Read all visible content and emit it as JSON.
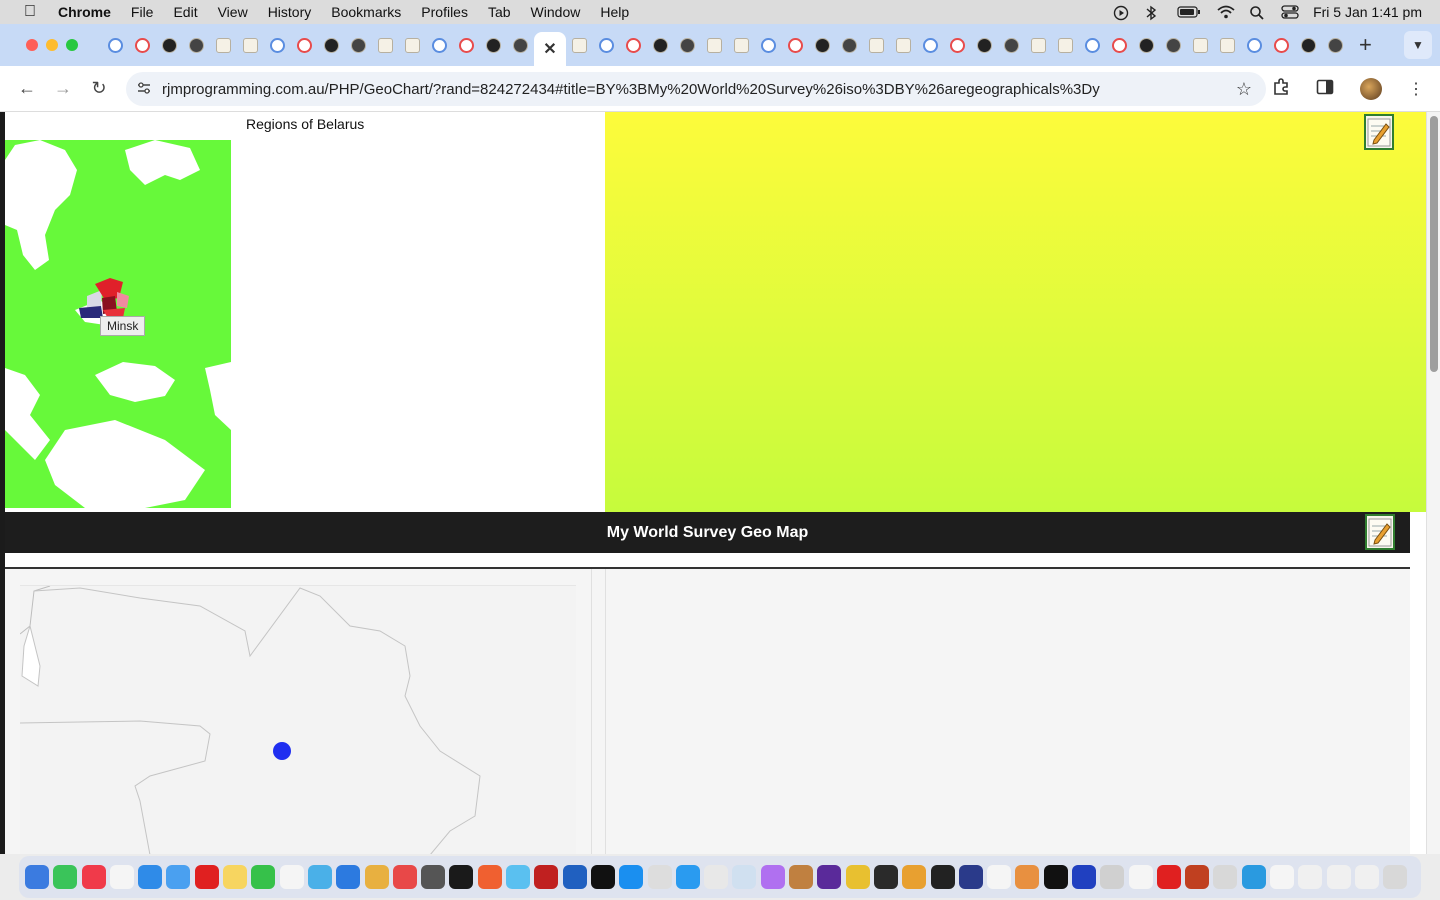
{
  "menubar": {
    "app_name": "Chrome",
    "items": [
      "File",
      "Edit",
      "View",
      "History",
      "Bookmarks",
      "Profiles",
      "Tab",
      "Window",
      "Help"
    ],
    "clock": "Fri 5 Jan  1:41 pm"
  },
  "tabs": {
    "active_close_glyph": "✕",
    "new_tab_glyph": "+",
    "tab_count_visible": 46
  },
  "toolbar": {
    "url": "rjmprogramming.com.au/PHP/GeoChart/?rand=824272434#title=BY%3BMy%20World%20Survey%26iso%3DBY%26aregeographicals%3Dy"
  },
  "page": {
    "map_label": "Regions of Belarus",
    "tooltip": "Minsk",
    "title": "My World Survey Geo Map"
  },
  "colors": {
    "map_land": "#67f93a",
    "panel_top": "#fdfb3b",
    "panel_bottom": "#c6fb3c",
    "marker": "#1f2ef0",
    "title_bar": "#1d1d1d"
  },
  "icons": {
    "edit": "edit-notepad-icon",
    "star": "bookmark-star-icon",
    "back": "back-arrow-icon",
    "forward": "forward-arrow-icon",
    "reload": "reload-icon"
  }
}
